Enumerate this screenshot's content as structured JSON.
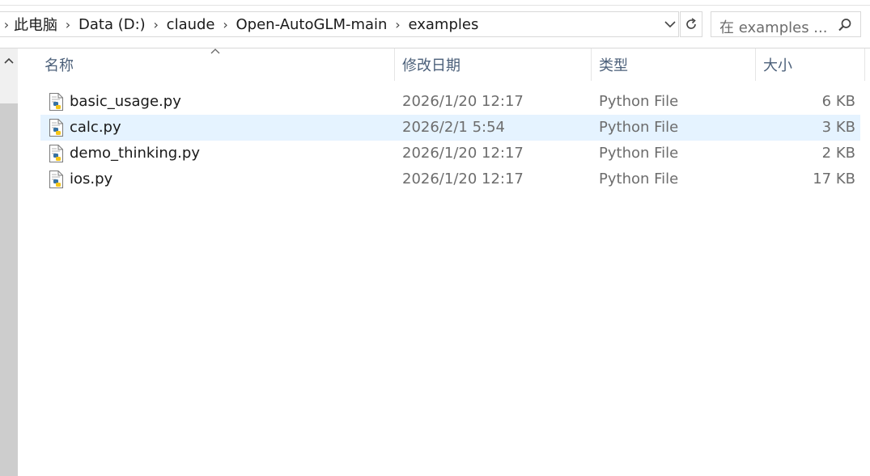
{
  "breadcrumbs": [
    "此电脑",
    "Data (D:)",
    "claude",
    "Open-AutoGLM-main",
    "examples"
  ],
  "search": {
    "placeholder": "在 examples ..."
  },
  "columns": {
    "name": "名称",
    "date": "修改日期",
    "type": "类型",
    "size": "大小"
  },
  "files": [
    {
      "name": "basic_usage.py",
      "date": "2026/1/20 12:17",
      "type": "Python File",
      "size": "6 KB",
      "selected": false
    },
    {
      "name": "calc.py",
      "date": "2026/2/1 5:54",
      "type": "Python File",
      "size": "3 KB",
      "selected": true
    },
    {
      "name": "demo_thinking.py",
      "date": "2026/1/20 12:17",
      "type": "Python File",
      "size": "2 KB",
      "selected": false
    },
    {
      "name": "ios.py",
      "date": "2026/1/20 12:17",
      "type": "Python File",
      "size": "17 KB",
      "selected": false
    }
  ],
  "colors": {
    "accent_header": "#4c607a",
    "selection": "#e5f3ff",
    "python_blue": "#3772a3",
    "python_yellow": "#f5c518"
  },
  "icons": {
    "file": "python-file-icon",
    "search": "search-icon",
    "refresh": "refresh-icon",
    "dropdown": "chevron-down-icon"
  }
}
